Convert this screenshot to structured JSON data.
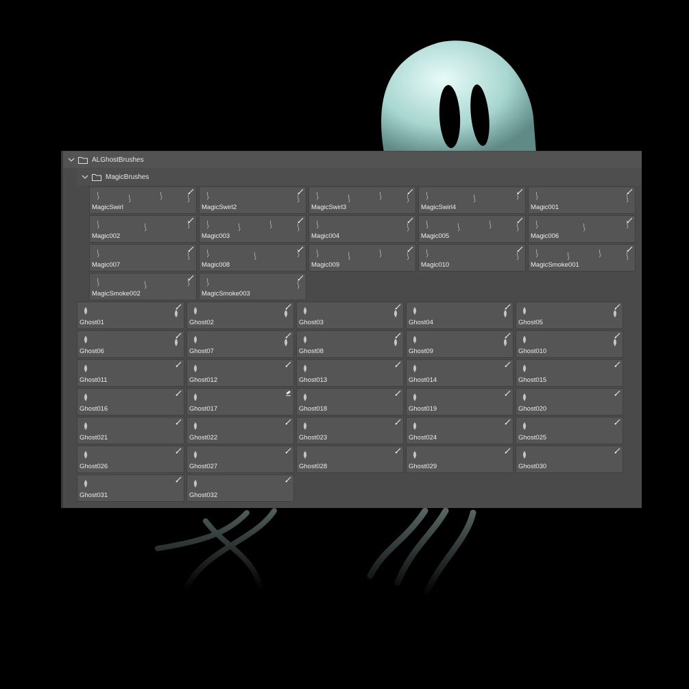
{
  "panel": {
    "root_folder": "ALGhostBrushes",
    "sub_folder": "MagicBrushes"
  },
  "magic_brushes": [
    "MagicSwirl",
    "MagicSwirl2",
    "MagicSwirl3",
    "MagicSwirl4",
    "Magic001",
    "Magic002",
    "Magic003",
    "Magic004",
    "Magic005",
    "Magic006",
    "Magic007",
    "Magic008",
    "Magic009",
    "Magic010",
    "MagicSmoke001",
    "MagicSmoke002",
    "MagicSmoke003"
  ],
  "ghost_brushes": [
    "Ghost01",
    "Ghost02",
    "Ghost03",
    "Ghost04",
    "Ghost05",
    "Ghost06",
    "Ghost07",
    "Ghost08",
    "Ghost09",
    "Ghost010",
    "Ghost011",
    "Ghost012",
    "Ghost013",
    "Ghost014",
    "Ghost015",
    "Ghost016",
    "Ghost017",
    "Ghost018",
    "Ghost019",
    "Ghost020",
    "Ghost021",
    "Ghost022",
    "Ghost023",
    "Ghost024",
    "Ghost025",
    "Ghost026",
    "Ghost027",
    "Ghost028",
    "Ghost029",
    "Ghost030",
    "Ghost031",
    "Ghost032"
  ],
  "icons": {
    "expand": "chevron-down-icon",
    "folder": "folder-icon",
    "brush_tool": "brush-tool-icon",
    "eraser_tool": "eraser-tool-icon"
  },
  "colors": {
    "background": "#000000",
    "panel": "#4a4a4a",
    "tile": "#555555",
    "ghost": "#cfeeea"
  }
}
